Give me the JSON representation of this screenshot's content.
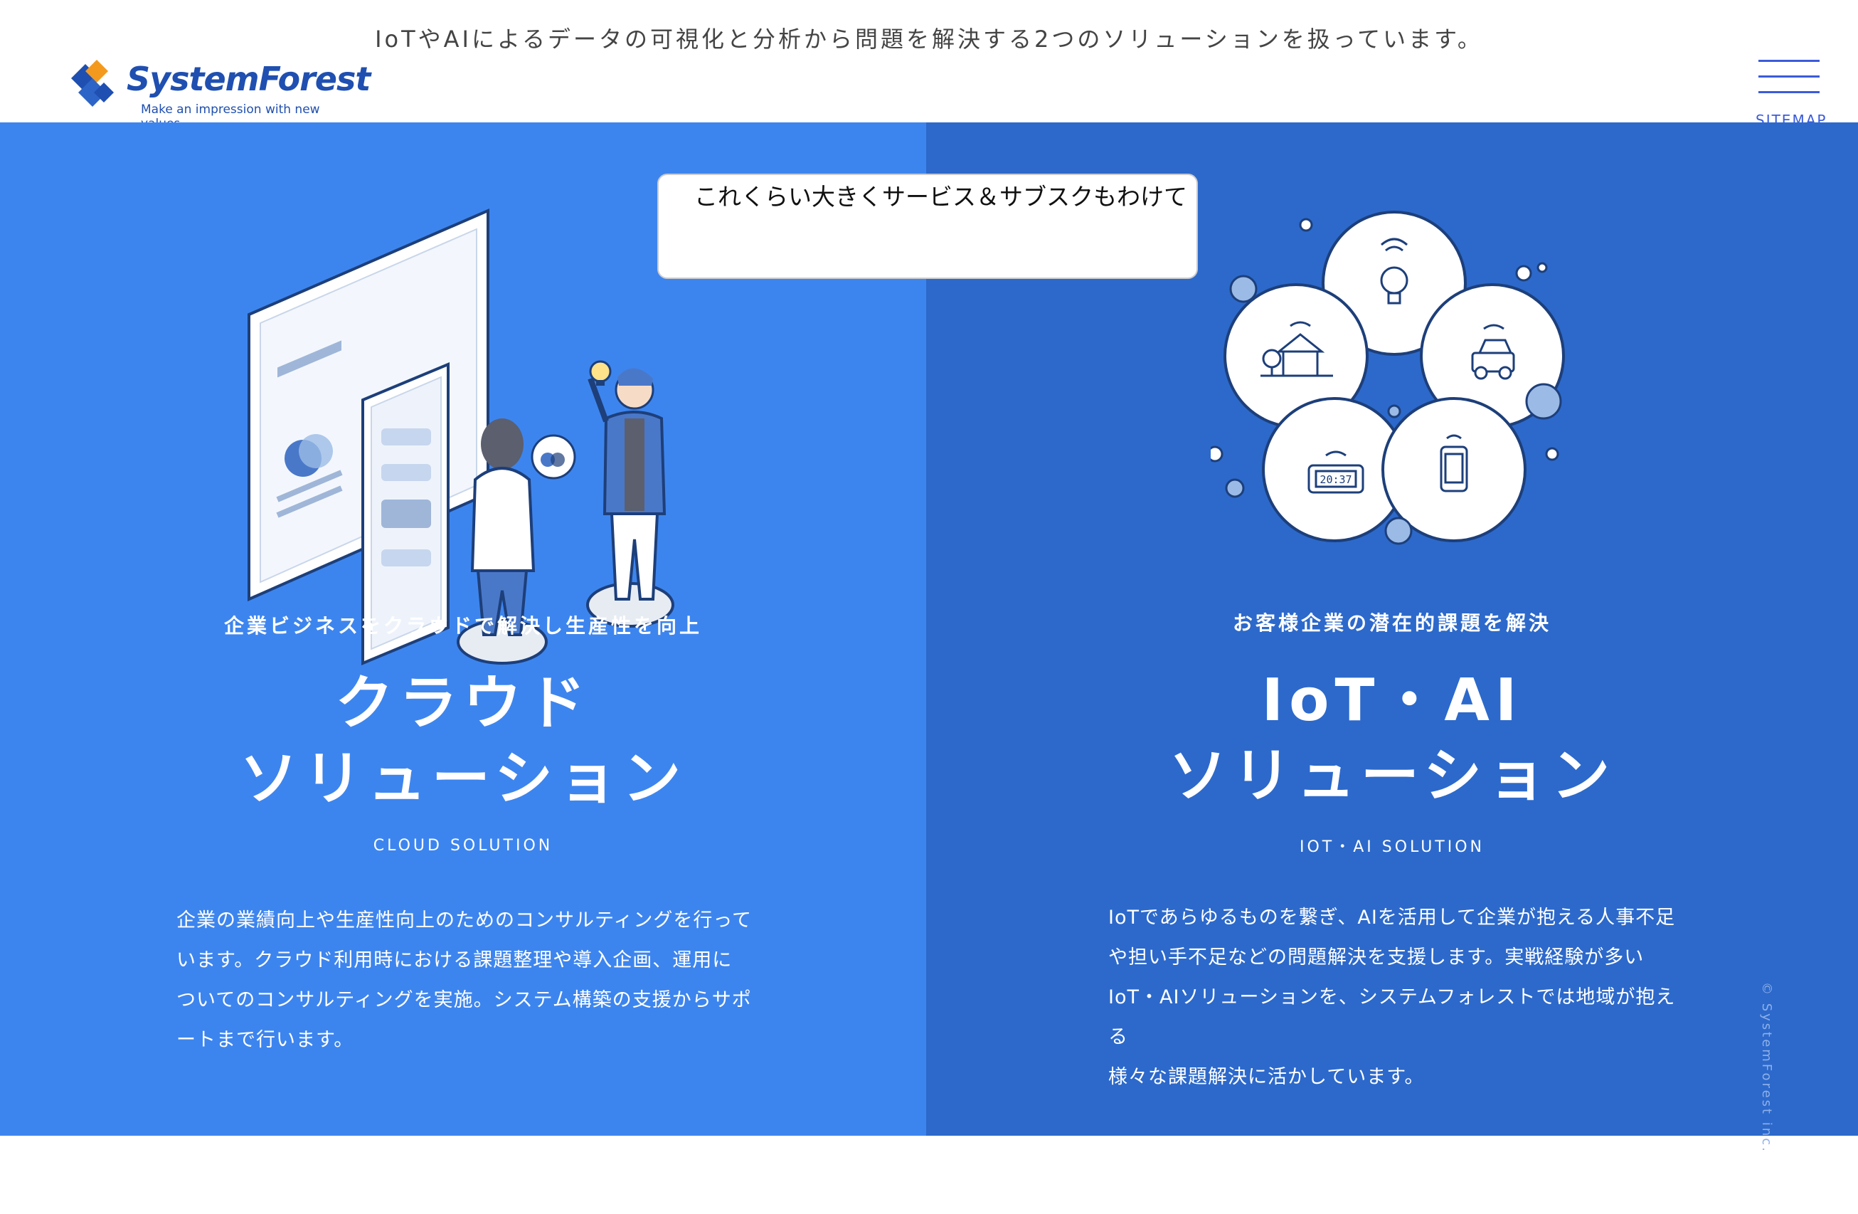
{
  "header": {
    "tagline": "IoTやAIによるデータの可視化と分析から問題を解決する2つのソリューションを扱っています。",
    "logo_name": "SystemForest",
    "logo_sub": "Make an impression with new values",
    "menu_label": "SITEMAP"
  },
  "annotation": {
    "text": "これくらい大きくサービス＆サブスクもわけて"
  },
  "cloud": {
    "catch": "企業ビジネスをクラウドで解決し生産性を向上",
    "title_line1": "クラウド",
    "title_line2": "ソリューション",
    "en_label": "CLOUD SOLUTION",
    "desc_lines": [
      "企業の業績向上や生産性向上のためのコンサルティングを行って",
      "います。クラウド利用時における課題整理や導入企画、運用に",
      "ついてのコンサルティングを実施。システム構築の支援からサポ",
      "ートまで行います。"
    ]
  },
  "iot": {
    "catch": "お客様企業の潜在的課題を解決",
    "title_line1": "IoT・AI",
    "title_line2": "ソリューション",
    "en_label": "IOT・AI SOLUTION",
    "desc_lines": [
      "IoTであらゆるものを繋ぎ、AIを活用して企業が抱える人事不足",
      "や担い手不足などの問題解決を支援します。実戦経験が多い",
      "IoT・AIソリューションを、システムフォレストでは地域が抱える",
      "様々な課題解決に活かしています。"
    ],
    "clock_display": "20:37"
  },
  "side": {
    "copyright": "© SystemForest inc."
  },
  "colors": {
    "cloud_bg": "#3d85ee",
    "iot_bg": "#2c69cb",
    "brand": "#1f4fb0",
    "accent_orange": "#f39a1e"
  }
}
